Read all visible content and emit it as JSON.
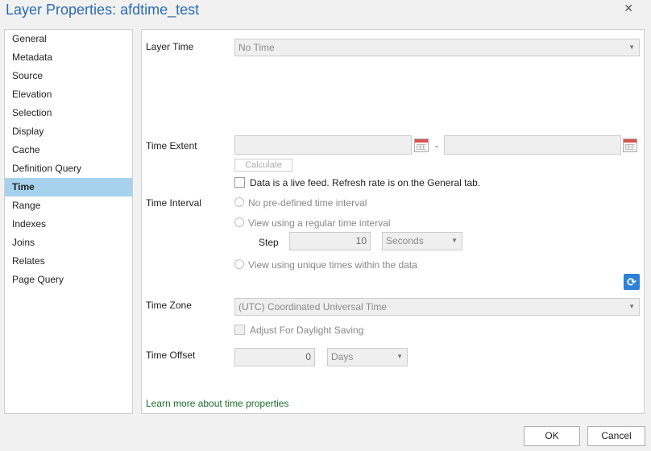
{
  "window": {
    "title": "Layer Properties: afdtime_test",
    "close_glyph": "✕"
  },
  "sidebar": {
    "items": [
      {
        "label": "General"
      },
      {
        "label": "Metadata"
      },
      {
        "label": "Source"
      },
      {
        "label": "Elevation"
      },
      {
        "label": "Selection"
      },
      {
        "label": "Display"
      },
      {
        "label": "Cache"
      },
      {
        "label": "Definition Query"
      },
      {
        "label": "Time",
        "selected": true
      },
      {
        "label": "Range"
      },
      {
        "label": "Indexes"
      },
      {
        "label": "Joins"
      },
      {
        "label": "Relates"
      },
      {
        "label": "Page Query"
      }
    ]
  },
  "time": {
    "layer_time": {
      "label": "Layer Time",
      "value": "No Time"
    },
    "time_extent": {
      "label": "Time Extent",
      "start": "",
      "end": "",
      "separator": "-"
    },
    "calculate_label": "Calculate",
    "live_feed_label": "Data is a live feed. Refresh rate is on the General tab.",
    "time_interval": {
      "label": "Time Interval",
      "option_none": "No pre-defined time interval",
      "option_regular": "View using a regular time interval",
      "step_label": "Step",
      "step_value": "10",
      "step_unit": "Seconds",
      "option_unique": "View using unique times within the data"
    },
    "time_zone": {
      "label": "Time Zone",
      "value": "(UTC) Coordinated Universal Time",
      "dst_label": "Adjust For Daylight Saving"
    },
    "time_offset": {
      "label": "Time Offset",
      "value": "0",
      "unit": "Days"
    },
    "learn_more": "Learn more about time properties"
  },
  "footer": {
    "ok_label": "OK",
    "cancel_label": "Cancel"
  },
  "colors": {
    "accent": "#2b6cb0",
    "selection": "#a7d2ee",
    "link": "#1b6e2a",
    "refresh": "#2b82d6"
  }
}
